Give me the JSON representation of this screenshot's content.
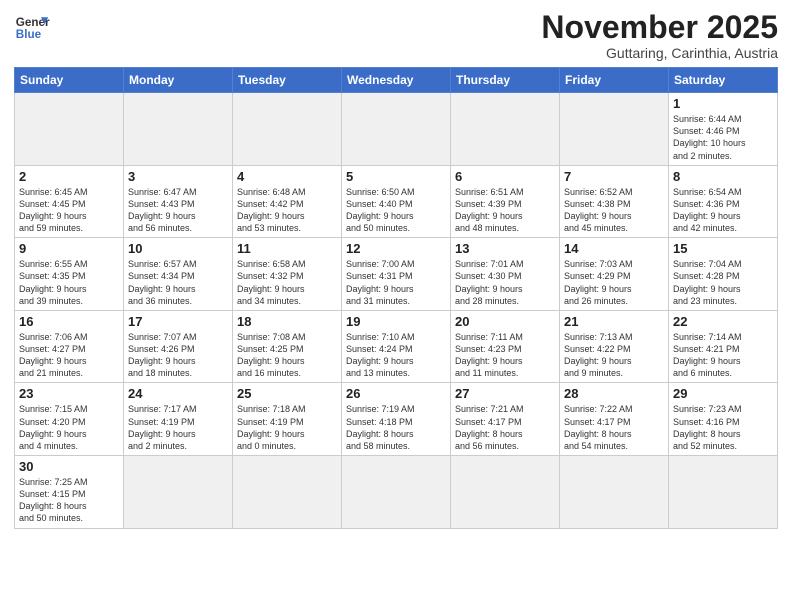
{
  "logo": {
    "text_normal": "General",
    "text_bold": "Blue"
  },
  "title": "November 2025",
  "subtitle": "Guttaring, Carinthia, Austria",
  "days_of_week": [
    "Sunday",
    "Monday",
    "Tuesday",
    "Wednesday",
    "Thursday",
    "Friday",
    "Saturday"
  ],
  "weeks": [
    [
      {
        "day": "",
        "info": "",
        "empty": true
      },
      {
        "day": "",
        "info": "",
        "empty": true
      },
      {
        "day": "",
        "info": "",
        "empty": true
      },
      {
        "day": "",
        "info": "",
        "empty": true
      },
      {
        "day": "",
        "info": "",
        "empty": true
      },
      {
        "day": "",
        "info": "",
        "empty": true
      },
      {
        "day": "1",
        "info": "Sunrise: 6:44 AM\nSunset: 4:46 PM\nDaylight: 10 hours\nand 2 minutes.",
        "empty": false
      }
    ],
    [
      {
        "day": "2",
        "info": "Sunrise: 6:45 AM\nSunset: 4:45 PM\nDaylight: 9 hours\nand 59 minutes.",
        "empty": false
      },
      {
        "day": "3",
        "info": "Sunrise: 6:47 AM\nSunset: 4:43 PM\nDaylight: 9 hours\nand 56 minutes.",
        "empty": false
      },
      {
        "day": "4",
        "info": "Sunrise: 6:48 AM\nSunset: 4:42 PM\nDaylight: 9 hours\nand 53 minutes.",
        "empty": false
      },
      {
        "day": "5",
        "info": "Sunrise: 6:50 AM\nSunset: 4:40 PM\nDaylight: 9 hours\nand 50 minutes.",
        "empty": false
      },
      {
        "day": "6",
        "info": "Sunrise: 6:51 AM\nSunset: 4:39 PM\nDaylight: 9 hours\nand 48 minutes.",
        "empty": false
      },
      {
        "day": "7",
        "info": "Sunrise: 6:52 AM\nSunset: 4:38 PM\nDaylight: 9 hours\nand 45 minutes.",
        "empty": false
      },
      {
        "day": "8",
        "info": "Sunrise: 6:54 AM\nSunset: 4:36 PM\nDaylight: 9 hours\nand 42 minutes.",
        "empty": false
      }
    ],
    [
      {
        "day": "9",
        "info": "Sunrise: 6:55 AM\nSunset: 4:35 PM\nDaylight: 9 hours\nand 39 minutes.",
        "empty": false
      },
      {
        "day": "10",
        "info": "Sunrise: 6:57 AM\nSunset: 4:34 PM\nDaylight: 9 hours\nand 36 minutes.",
        "empty": false
      },
      {
        "day": "11",
        "info": "Sunrise: 6:58 AM\nSunset: 4:32 PM\nDaylight: 9 hours\nand 34 minutes.",
        "empty": false
      },
      {
        "day": "12",
        "info": "Sunrise: 7:00 AM\nSunset: 4:31 PM\nDaylight: 9 hours\nand 31 minutes.",
        "empty": false
      },
      {
        "day": "13",
        "info": "Sunrise: 7:01 AM\nSunset: 4:30 PM\nDaylight: 9 hours\nand 28 minutes.",
        "empty": false
      },
      {
        "day": "14",
        "info": "Sunrise: 7:03 AM\nSunset: 4:29 PM\nDaylight: 9 hours\nand 26 minutes.",
        "empty": false
      },
      {
        "day": "15",
        "info": "Sunrise: 7:04 AM\nSunset: 4:28 PM\nDaylight: 9 hours\nand 23 minutes.",
        "empty": false
      }
    ],
    [
      {
        "day": "16",
        "info": "Sunrise: 7:06 AM\nSunset: 4:27 PM\nDaylight: 9 hours\nand 21 minutes.",
        "empty": false
      },
      {
        "day": "17",
        "info": "Sunrise: 7:07 AM\nSunset: 4:26 PM\nDaylight: 9 hours\nand 18 minutes.",
        "empty": false
      },
      {
        "day": "18",
        "info": "Sunrise: 7:08 AM\nSunset: 4:25 PM\nDaylight: 9 hours\nand 16 minutes.",
        "empty": false
      },
      {
        "day": "19",
        "info": "Sunrise: 7:10 AM\nSunset: 4:24 PM\nDaylight: 9 hours\nand 13 minutes.",
        "empty": false
      },
      {
        "day": "20",
        "info": "Sunrise: 7:11 AM\nSunset: 4:23 PM\nDaylight: 9 hours\nand 11 minutes.",
        "empty": false
      },
      {
        "day": "21",
        "info": "Sunrise: 7:13 AM\nSunset: 4:22 PM\nDaylight: 9 hours\nand 9 minutes.",
        "empty": false
      },
      {
        "day": "22",
        "info": "Sunrise: 7:14 AM\nSunset: 4:21 PM\nDaylight: 9 hours\nand 6 minutes.",
        "empty": false
      }
    ],
    [
      {
        "day": "23",
        "info": "Sunrise: 7:15 AM\nSunset: 4:20 PM\nDaylight: 9 hours\nand 4 minutes.",
        "empty": false
      },
      {
        "day": "24",
        "info": "Sunrise: 7:17 AM\nSunset: 4:19 PM\nDaylight: 9 hours\nand 2 minutes.",
        "empty": false
      },
      {
        "day": "25",
        "info": "Sunrise: 7:18 AM\nSunset: 4:19 PM\nDaylight: 9 hours\nand 0 minutes.",
        "empty": false
      },
      {
        "day": "26",
        "info": "Sunrise: 7:19 AM\nSunset: 4:18 PM\nDaylight: 8 hours\nand 58 minutes.",
        "empty": false
      },
      {
        "day": "27",
        "info": "Sunrise: 7:21 AM\nSunset: 4:17 PM\nDaylight: 8 hours\nand 56 minutes.",
        "empty": false
      },
      {
        "day": "28",
        "info": "Sunrise: 7:22 AM\nSunset: 4:17 PM\nDaylight: 8 hours\nand 54 minutes.",
        "empty": false
      },
      {
        "day": "29",
        "info": "Sunrise: 7:23 AM\nSunset: 4:16 PM\nDaylight: 8 hours\nand 52 minutes.",
        "empty": false
      }
    ],
    [
      {
        "day": "30",
        "info": "Sunrise: 7:25 AM\nSunset: 4:15 PM\nDaylight: 8 hours\nand 50 minutes.",
        "empty": false
      },
      {
        "day": "",
        "info": "",
        "empty": true
      },
      {
        "day": "",
        "info": "",
        "empty": true
      },
      {
        "day": "",
        "info": "",
        "empty": true
      },
      {
        "day": "",
        "info": "",
        "empty": true
      },
      {
        "day": "",
        "info": "",
        "empty": true
      },
      {
        "day": "",
        "info": "",
        "empty": true
      }
    ]
  ]
}
